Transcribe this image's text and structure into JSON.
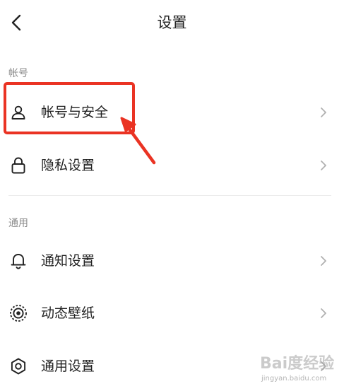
{
  "nav": {
    "title": "设置",
    "back_icon": "chevron-left-icon"
  },
  "sections": [
    {
      "header": "帐号",
      "items": [
        {
          "label": "帐号与安全",
          "icon": "user-icon"
        },
        {
          "label": "隐私设置",
          "icon": "lock-icon"
        }
      ]
    },
    {
      "header": "通用",
      "items": [
        {
          "label": "通知设置",
          "icon": "bell-icon"
        },
        {
          "label": "动态壁纸",
          "icon": "live-wallpaper-icon"
        },
        {
          "label": "通用设置",
          "icon": "gear-icon"
        }
      ]
    }
  ],
  "annotation": {
    "highlight_color": "#ea3323"
  },
  "watermark": {
    "brand": "Bai度经验",
    "url": "jingyan.baidu.com"
  },
  "colors": {
    "text": "#222222",
    "section_header": "#8a8a8a",
    "chevron": "#b0b0b0",
    "divider": "#ececec"
  }
}
